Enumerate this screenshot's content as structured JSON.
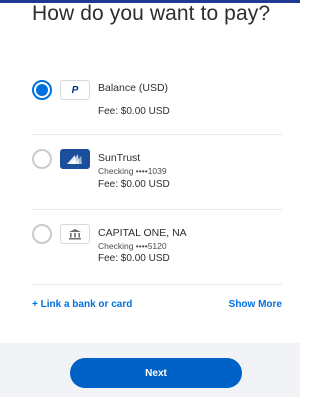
{
  "header": {
    "title": "How do you want to pay?"
  },
  "options": [
    {
      "name": "Balance (USD)",
      "detail": "",
      "fee": "Fee: $0.00 USD",
      "selected": true,
      "logo": "paypal-logo",
      "logo_text": "P"
    },
    {
      "name": "SunTrust",
      "detail": "Checking ••••1039",
      "fee": "Fee: $0.00 USD",
      "selected": false,
      "logo": "suntrust-logo"
    },
    {
      "name": "CAPITAL ONE, NA",
      "detail": "Checking ••••5120",
      "fee": "Fee: $0.00 USD",
      "selected": false,
      "logo": "bank-icon"
    }
  ],
  "actions": {
    "link_label": "+ Link a bank or card",
    "show_more_label": "Show More"
  },
  "footer": {
    "next_label": "Next"
  },
  "colors": {
    "accent": "#0070e0",
    "button": "#0062c6",
    "footer_bg": "#f1f3f6"
  }
}
